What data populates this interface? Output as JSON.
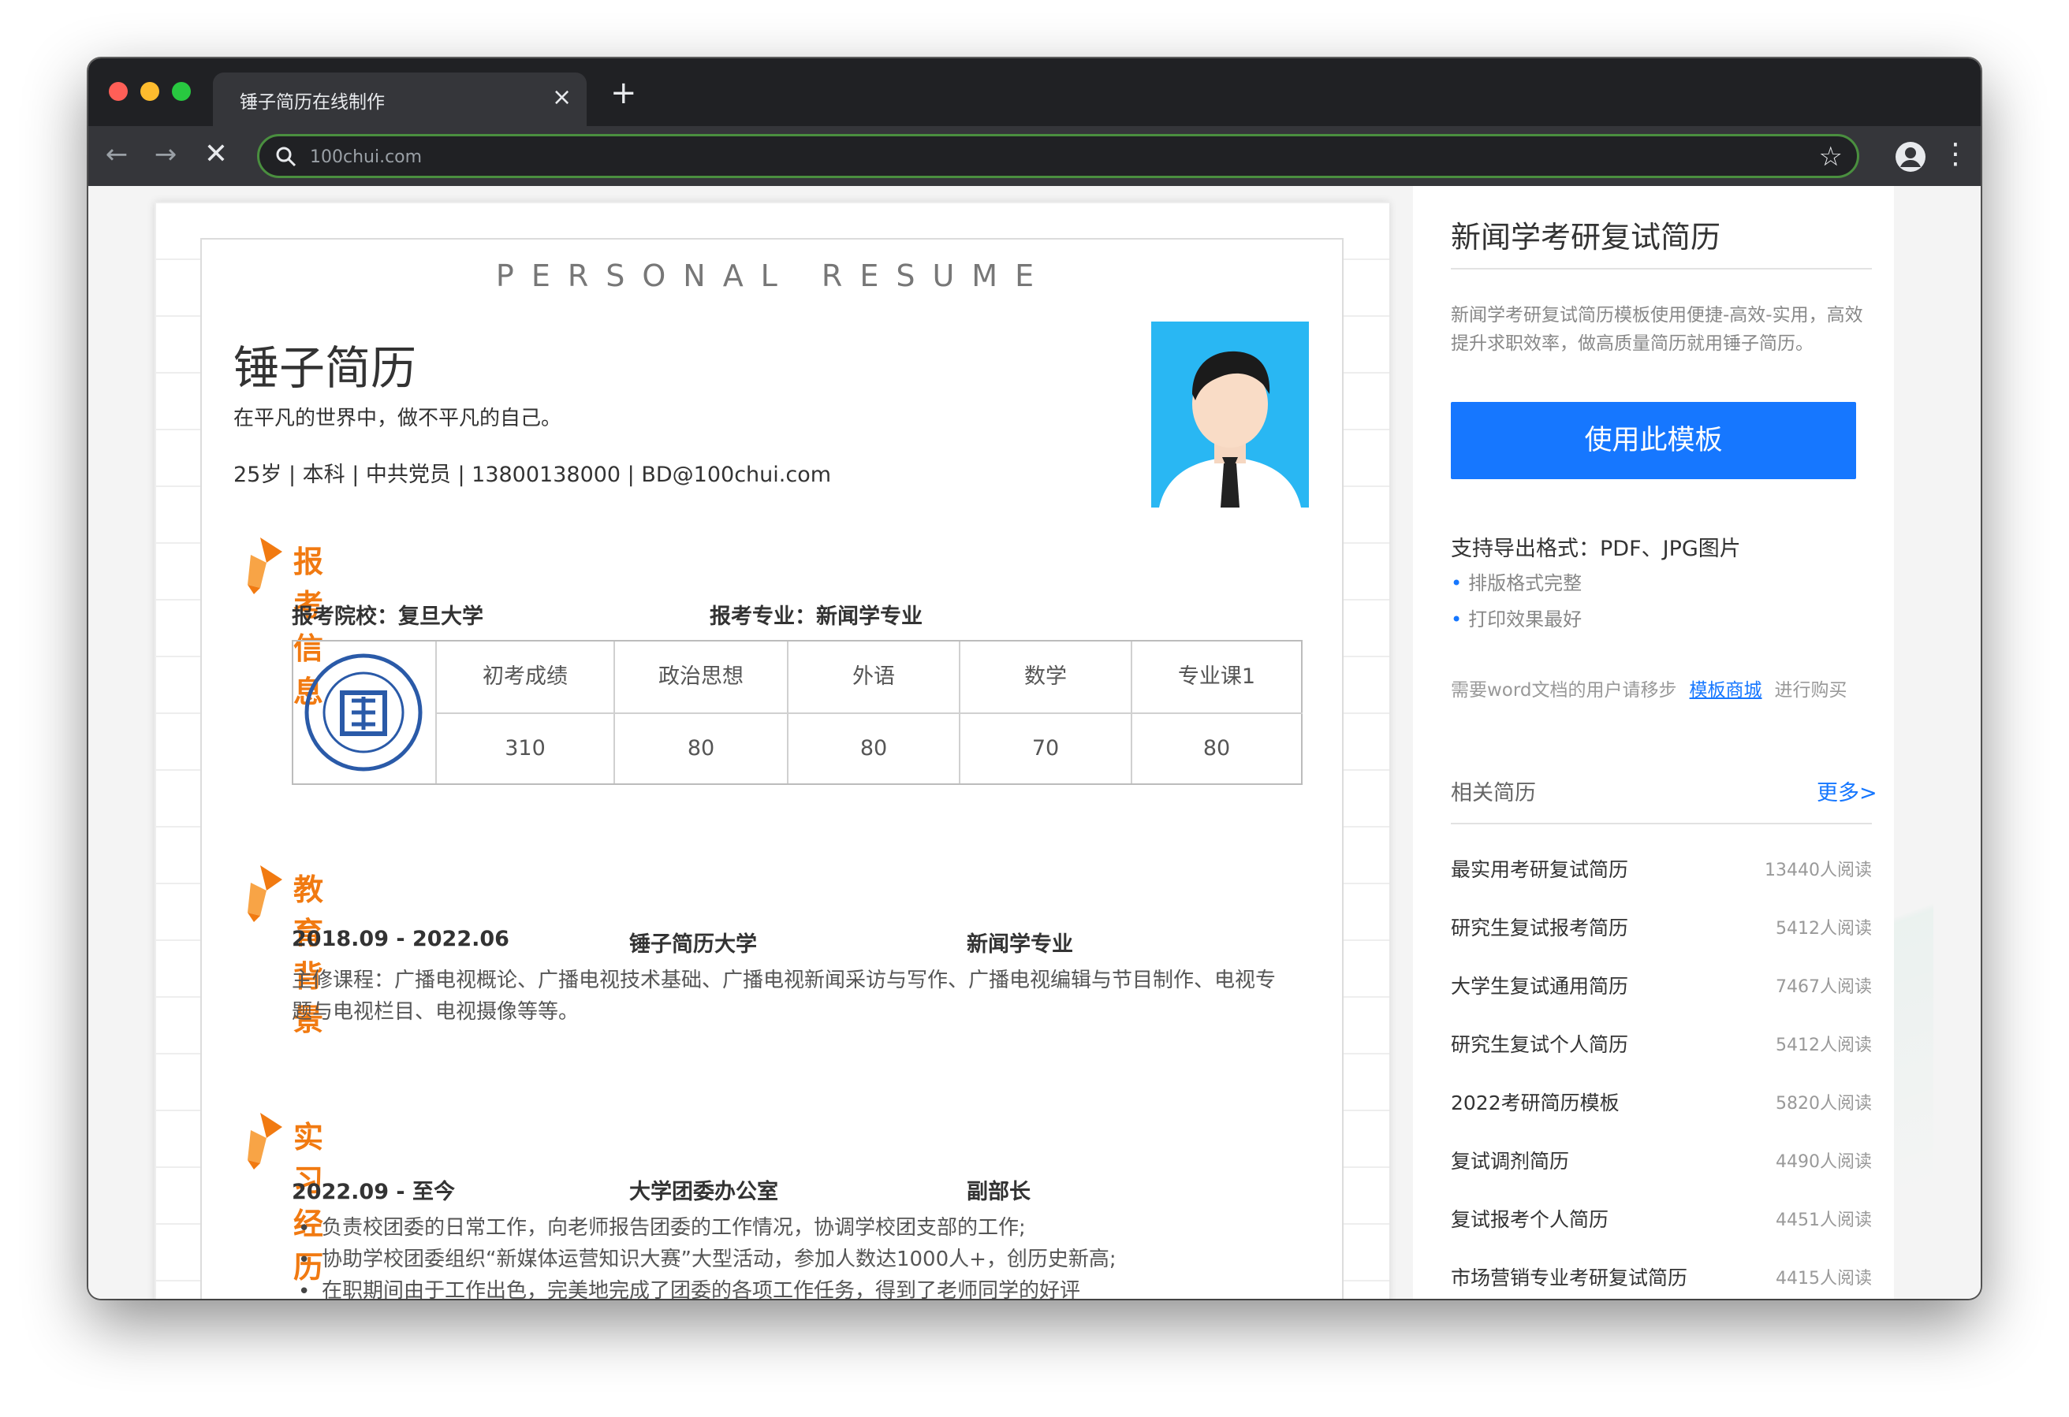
{
  "browser": {
    "tab_title": "锤子简历在线制作",
    "address": "100chui.com",
    "close_glyph": "×",
    "new_tab_glyph": "+",
    "back_glyph": "←",
    "forward_glyph": "→",
    "stop_glyph": "✕",
    "star_glyph": "☆",
    "menu_glyph": "⋮"
  },
  "resume": {
    "header_title": "PERSONAL RESUME",
    "name": "锤子简历",
    "motto": "在平凡的世界中，做不平凡的自己。",
    "info": "25岁 | 本科 | 中共党员 | 13800138000 | BD@100chui.com",
    "sections": {
      "exam": {
        "title": "报考信息",
        "school": "报考院校：复旦大学",
        "major": "报考专业：新闻学专业",
        "table": {
          "headers": [
            "初考成绩",
            "政治思想",
            "外语",
            "数学",
            "专业课1"
          ],
          "values": [
            "310",
            "80",
            "80",
            "70",
            "80"
          ]
        }
      },
      "education": {
        "title": "教育背景",
        "period": "2018.09 - 2022.06",
        "school": "锤子简历大学",
        "major": "新闻学专业",
        "courses_line1": "主修课程：广播电视概论、广播电视技术基础、广播电视新闻采访与写作、广播电视编辑与节目制作、电视专",
        "courses_line2": "题与电视栏目、电视摄像等等。"
      },
      "intern": {
        "title": "实习经历",
        "period": "2022.09 - 至今",
        "org": "大学团委办公室",
        "role": "副部长",
        "bullets": [
          "负责校团委的日常工作，向老师报告团委的工作情况，协调学校团支部的工作;",
          "协助学校团委组织“新媒体运营知识大赛”大型活动，参加人数达1000人+，创历史新高;",
          "在职期间由于工作出色，完美地完成了团委的各项工作任务，得到了老师同学的好评"
        ]
      }
    }
  },
  "sidebar": {
    "title": "新闻学考研复试简历",
    "description": "新闻学考研复试简历模板使用便捷-高效-实用，高效提升求职效率，做高质量简历就用锤子简历。",
    "use_button": "使用此模板",
    "formats": "支持导出格式：PDF、JPG图片",
    "features": [
      "排版格式完整",
      "打印效果最好"
    ],
    "word_prefix": "需要word文档的用户请移步",
    "word_link": "模板商城",
    "word_suffix": "进行购买",
    "related_title": "相关简历",
    "more": "更多>",
    "related": [
      {
        "title": "最实用考研复试简历",
        "reads": "13440人阅读"
      },
      {
        "title": "研究生复试报考简历",
        "reads": "5412人阅读"
      },
      {
        "title": "大学生复试通用简历",
        "reads": "7467人阅读"
      },
      {
        "title": "研究生复试个人简历",
        "reads": "5412人阅读"
      },
      {
        "title": "2022考研简历模板",
        "reads": "5820人阅读"
      },
      {
        "title": "复试调剂简历",
        "reads": "4490人阅读"
      },
      {
        "title": "复试报考个人简历",
        "reads": "4451人阅读"
      },
      {
        "title": "市场营销专业考研复试简历",
        "reads": "4415人阅读"
      }
    ]
  },
  "colors": {
    "accent": "#1677ff",
    "section_orange": "#f17a11",
    "avatar_bg": "#29b7f3"
  }
}
